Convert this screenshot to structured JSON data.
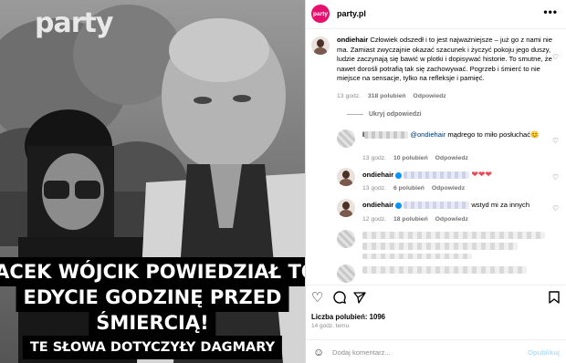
{
  "photo": {
    "logo": "party",
    "caption_lines": [
      "JACEK WÓJCIK POWIEDZIAŁ TO",
      "EDYCIE GODZINĘ PRZED",
      "ŚMIERCIĄ!"
    ],
    "subcaption": "TE SŁOWA DOTYCZYŁY DAGMARY"
  },
  "header": {
    "avatar_text": "party",
    "account": "party.pl",
    "more": "•••"
  },
  "main_comment": {
    "user": "ondiehair",
    "text": "Człowiek odszedł i to jest najważniejsze – już go z nami nie ma. Zamiast zwyczajnie okazać szacunek i życzyć pokoju jego duszy, ludzie zaczynają się bawić w plotki i dopisywać historie. To smutne, że nawet dorośli potrafią tak się zachowywać. Pogrzeb i śmierć to nie miejsce na sensacje, tylko na refleksje i pamięć.",
    "time": "13 godz.",
    "likes": "318 polubień",
    "reply": "Odpowiedz"
  },
  "hidden_replies": "Ukryj odpowiedzi",
  "replies": [
    {
      "user": "l",
      "mention": "@ondiehair",
      "text": "mądrego to miło posłuchać😊",
      "time": "13 godz.",
      "likes": "10 polubień",
      "reply": "Odpowiedz"
    },
    {
      "user": "ondiehair",
      "hearts": "❤❤❤",
      "time": "13 godz.",
      "likes": "6 polubień",
      "reply": "Odpowiedz"
    },
    {
      "user": "ondiehair",
      "text": "wstyd mi za innych",
      "time": "12 godz.",
      "likes": "18 polubień",
      "reply": "Odpowiedz"
    }
  ],
  "likes_count": "Liczba polubień: 1096",
  "time_ago": "14 godz. temu",
  "add_comment": {
    "placeholder": "Dodaj komentarz...",
    "publish": "Opublikuj"
  },
  "icons": {
    "heart": "heart-outline-icon",
    "comment": "comment-bubble-icon",
    "share": "paper-plane-icon",
    "save": "bookmark-icon",
    "emoji": "smiley-icon"
  }
}
